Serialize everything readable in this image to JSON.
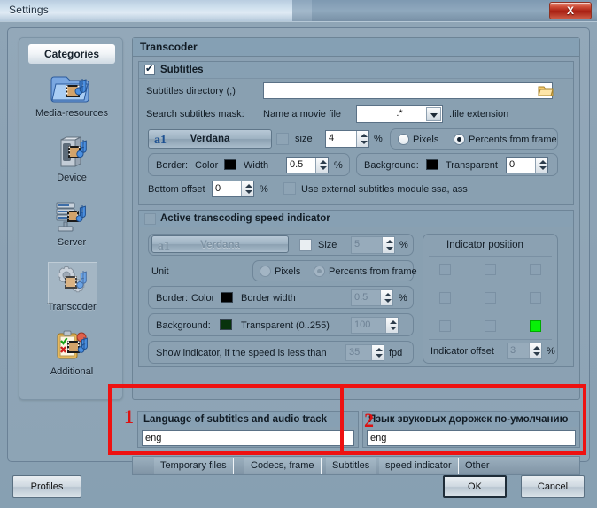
{
  "window": {
    "title": "Settings",
    "close_label": "X"
  },
  "sidebar": {
    "header": "Categories",
    "items": [
      {
        "label": "Media-resources",
        "icon": "folder-media-icon",
        "selected": false
      },
      {
        "label": "Device",
        "icon": "device-media-icon",
        "selected": false
      },
      {
        "label": "Server",
        "icon": "server-media-icon",
        "selected": false
      },
      {
        "label": "Transcoder",
        "icon": "gears-media-icon",
        "selected": true
      },
      {
        "label": "Additional",
        "icon": "clipboard-media-icon",
        "selected": false
      }
    ]
  },
  "panel": {
    "title": "Transcoder"
  },
  "subtitles": {
    "group_title": "Subtitles",
    "enabled": true,
    "directory_label": "Subtitles directory (;)",
    "directory_value": "",
    "browse_icon": "open-folder-icon",
    "mask_label": "Search subtitles mask:",
    "mask_prefix": "Name a movie file",
    "mask_value": ".*",
    "mask_suffix": ".file extension",
    "font_name": "Verdana",
    "font_icon": "a1-font-icon",
    "size_label": "size",
    "size_checked": false,
    "size_value": "4",
    "percent_sign": "%",
    "unit_pixels": "Pixels",
    "unit_percents": "Percents from frame",
    "unit_selected": "percents",
    "border_label": "Border:",
    "border_color_label": "Color",
    "border_color": "#000000",
    "border_width_label": "Width",
    "border_width_value": "0.5",
    "background_label": "Background:",
    "background_color": "#000000",
    "transparent_label": "Transparent",
    "transparent_value": "0",
    "bottom_offset_label": "Bottom offset",
    "bottom_offset_value": "0",
    "ssa_label": "Use external subtitles module ssa, ass",
    "ssa_checked": false
  },
  "speed_indicator": {
    "group_title": "Active transcoding speed indicator",
    "enabled": false,
    "font_name": "Verdana",
    "font_icon": "a1-font-icon",
    "size_label": "Size",
    "size_checked": false,
    "size_value": "5",
    "percent_sign": "%",
    "unit_label": "Unit",
    "unit_pixels": "Pixels",
    "unit_percents": "Percents from frame",
    "unit_selected": "percents",
    "border_label": "Border:",
    "border_color_label": "Color",
    "border_color": "#000000",
    "border_width_label": "Border width",
    "border_width_value": "0.5",
    "background_label": "Background:",
    "background_color": "#08330d",
    "transparent_label": "Transparent (0..255)",
    "transparent_value": "100",
    "show_if_label": "Show indicator, if the speed is less than",
    "show_if_value": "35",
    "show_if_unit": "fpd",
    "position_title": "Indicator position",
    "position_selected_index": 8,
    "position_active_color": "#07f007",
    "offset_label": "Indicator offset",
    "offset_value": "3"
  },
  "language": {
    "left_label": "Language of subtitles and audio track",
    "left_value": "eng",
    "right_label": "Язык звуковых дорожек по-умолчанию",
    "right_value": "eng"
  },
  "tabs": [
    {
      "label": "Temporary files"
    },
    {
      "label": "Codecs, frame"
    },
    {
      "label": "Subtitles"
    },
    {
      "label": "speed indicator"
    },
    {
      "label": "Other"
    }
  ],
  "footer": {
    "profiles": "Profiles",
    "ok": "OK",
    "cancel": "Cancel"
  },
  "annotations": [
    {
      "number": "1"
    },
    {
      "number": "2"
    }
  ]
}
